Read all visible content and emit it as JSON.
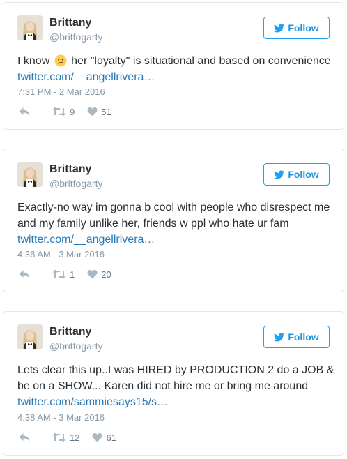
{
  "colors": {
    "link": "#2b7bb9",
    "follow": "#1da1f2",
    "muted": "#8899a6"
  },
  "icons": [
    "twitter-bird-icon",
    "reply-icon",
    "retweet-icon",
    "heart-icon",
    "confused-emoji-icon"
  ],
  "tweets": [
    {
      "name": "Brittany",
      "handle": "@britfogarty",
      "follow_label": "Follow",
      "text_before": "I know",
      "text_after": "her \"loyalty\" is situational and based on convenience",
      "link": "twitter.com/__angellrivera…",
      "timestamp": "7:31 PM - 2 Mar 2016",
      "retweets": "9",
      "likes": "51"
    },
    {
      "name": "Brittany",
      "handle": "@britfogarty",
      "follow_label": "Follow",
      "text": "Exactly-no way im gonna b cool with people who disrespect me and my family unlike her, friends w ppl who hate ur fam",
      "link": "twitter.com/__angellrivera…",
      "timestamp": "4:36 AM - 3 Mar 2016",
      "retweets": "1",
      "likes": "20"
    },
    {
      "name": "Brittany",
      "handle": "@britfogarty",
      "follow_label": "Follow",
      "text": "Lets clear this up..I was HIRED by PRODUCTION 2 do a JOB & be on a SHOW... Karen did not hire me or bring me around",
      "link": "twitter.com/sammiesays15/s…",
      "timestamp": "4:38 AM - 3 Mar 2016",
      "retweets": "12",
      "likes": "61"
    }
  ]
}
